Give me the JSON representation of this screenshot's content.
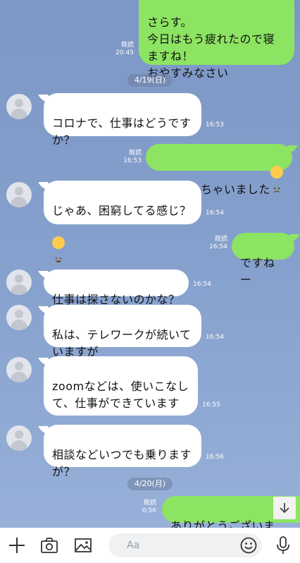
{
  "messages": [
    {
      "id": "m0",
      "dir": "out",
      "text": "さらす。\n今日はもう疲れたので寝ますね！\nおやすみなさい",
      "read": "既読",
      "time": "20:45"
    },
    {
      "id": "m1",
      "dir": "in",
      "text": "コロナで、仕事はどうですか？",
      "time": "16:53"
    },
    {
      "id": "m2",
      "dir": "out",
      "text": "なくなっちゃいました",
      "emoji": "crying-face",
      "read": "既読",
      "time": "16:53"
    },
    {
      "id": "m3",
      "dir": "in",
      "text": "じゃあ、困窮してる感じ？",
      "emoji": "sweat-smile",
      "time": "16:54"
    },
    {
      "id": "m4",
      "dir": "out",
      "text": "ですねー",
      "read": "既読",
      "time": "16:54"
    },
    {
      "id": "m5",
      "dir": "in",
      "text": "仕事は探さないのかな？",
      "time": "16:54"
    },
    {
      "id": "m6",
      "dir": "in",
      "text": "私は、テレワークが続いていますが",
      "time": "16:54"
    },
    {
      "id": "m7",
      "dir": "in",
      "text": "zoomなどは、使いこなして、仕事ができています",
      "emoji": "sweat-droplets",
      "time": "16:55"
    },
    {
      "id": "m8",
      "dir": "in",
      "text": "相談などいつでも乗りますが？",
      "time": "16:56"
    },
    {
      "id": "m9",
      "dir": "out",
      "text": "ありがとうございま",
      "read": "既読",
      "time": "0:56"
    }
  ],
  "dates": {
    "d1": "4/19(日)",
    "d2": "4/20(月)"
  },
  "input": {
    "placeholder": "Aa"
  },
  "icons": {
    "plus": "plus-icon",
    "camera": "camera-icon",
    "image": "image-icon",
    "emoji": "emoji-icon",
    "mic": "microphone-icon",
    "scroll": "arrow-down-icon"
  },
  "colors": {
    "outgoing": "#8ce462",
    "incoming": "#ffffff",
    "background": "#86a0cd"
  }
}
